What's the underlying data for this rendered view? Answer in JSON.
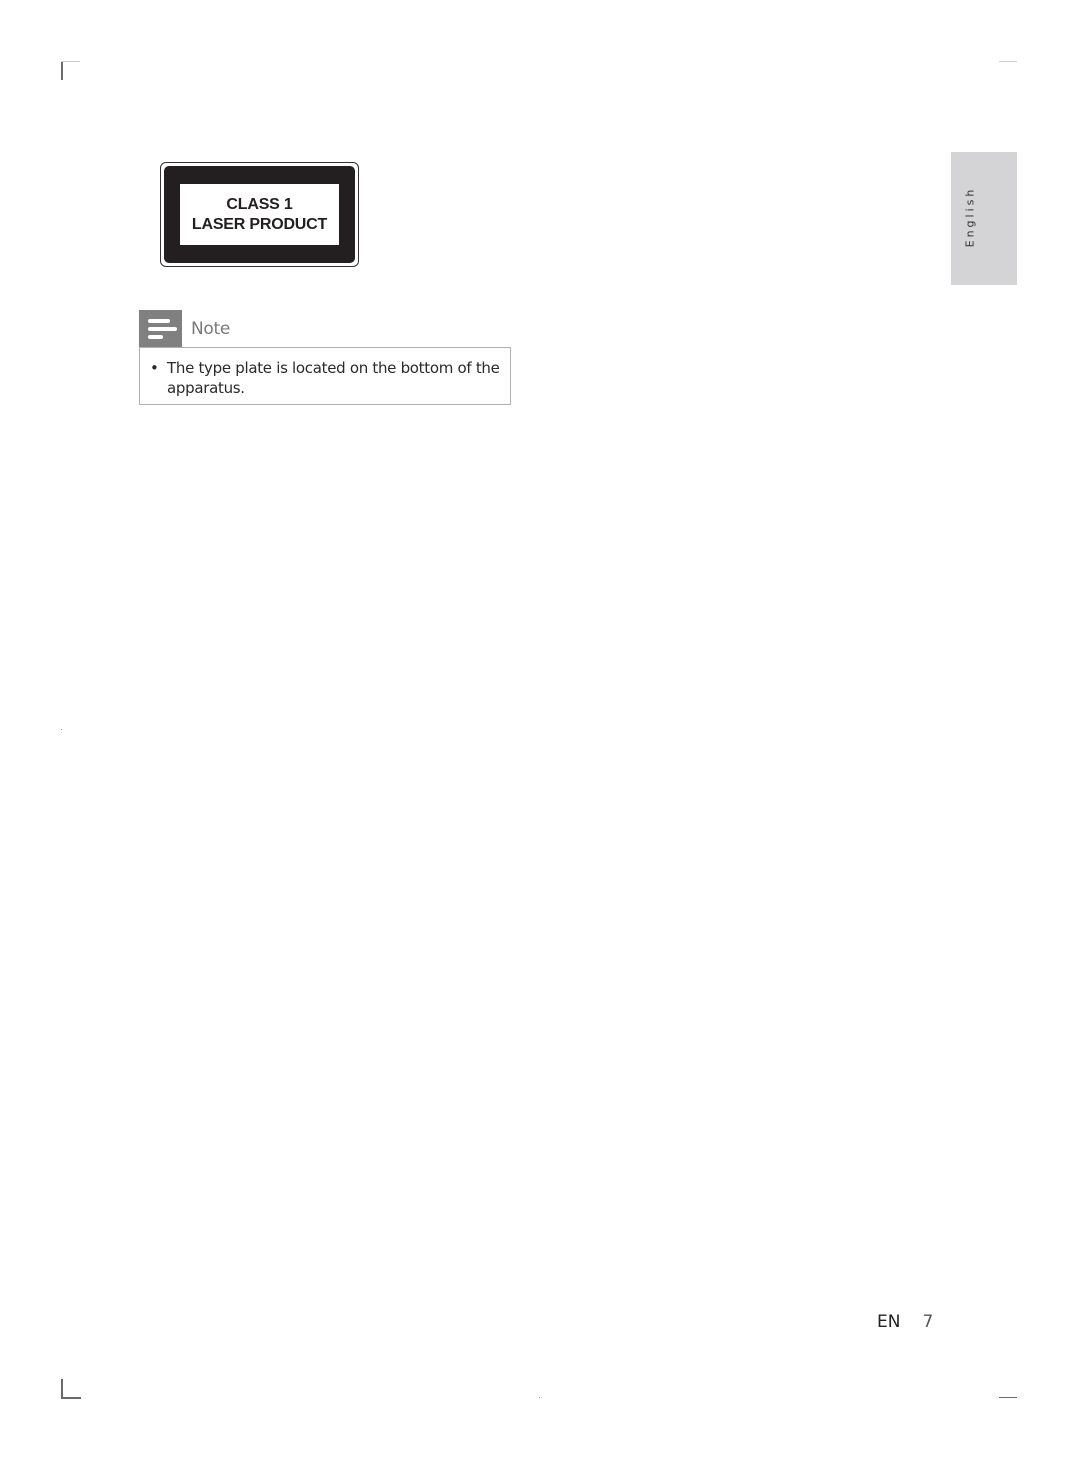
{
  "laser_label": {
    "line1": "CLASS 1",
    "line2": "LASER PRODUCT"
  },
  "note": {
    "icon": "note-lines-icon",
    "title": "Note",
    "items": [
      {
        "bullet": "•",
        "text": "The type plate is located on the bottom of the apparatus."
      }
    ]
  },
  "side_tab": {
    "language": "English"
  },
  "footer": {
    "lang_code": "EN",
    "page_number": "7"
  },
  "colors": {
    "label_black": "#231f20",
    "note_icon_bg": "#808080",
    "side_tab_bg": "#d4d4d6"
  }
}
